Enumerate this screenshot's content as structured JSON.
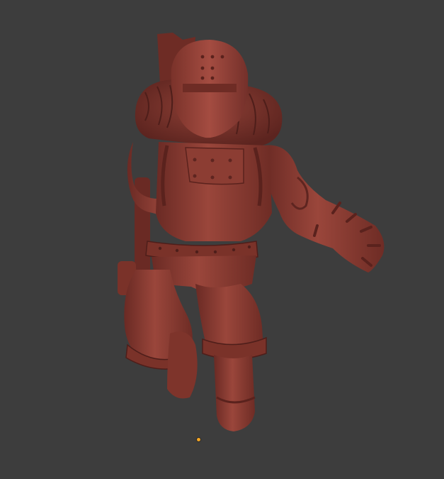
{
  "viewport": {
    "background_color": "#3d3d3d",
    "model_color": "#8b3b31",
    "model_highlight": "#a54b40",
    "model_shadow": "#5e2520",
    "origin_marker_color": "#f5a623",
    "subject": "sculpted-character-model"
  }
}
